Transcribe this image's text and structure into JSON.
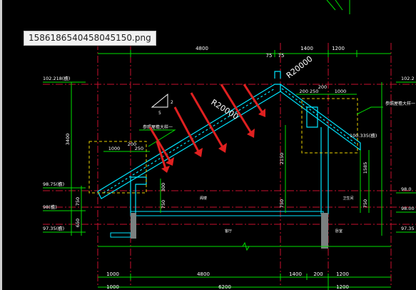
{
  "tooltip": {
    "filename": "1586186540458045150.png"
  },
  "dims": {
    "top": [
      "4800",
      "75",
      "75",
      "1400",
      "1200"
    ],
    "bottom_row1": [
      "1000",
      "4800",
      "1400",
      "200",
      "1200"
    ],
    "bottom_row2": [
      "1000",
      "6200",
      "1200"
    ],
    "right_sub": [
      "200 250",
      "200",
      "1000"
    ],
    "left_sub": [
      "1000",
      "200",
      "250"
    ]
  },
  "levels": {
    "left": [
      "102.218(檐)",
      "98.75(檐)",
      "98(檐)",
      "97.35(檐)"
    ],
    "right": [
      "102.2",
      "98.0",
      "98.00",
      "97.35"
    ],
    "mid_right": "100.335(檐)"
  },
  "vertical_dims": {
    "left_total": "3400",
    "left_a": "750",
    "left_b": "650",
    "mid_a": "300",
    "mid_b": "750",
    "center_a": "2150",
    "center_b": "750",
    "right_a": "1585",
    "right_b": "750"
  },
  "slopes": {
    "left_label": "R20000",
    "right_label": "R20000"
  },
  "notes": {
    "left_note": "参照屋檐大样一",
    "right_note": "参照屋檐大样一"
  },
  "rooms": {
    "upper_left": "阁楼",
    "upper_right": "卫生间",
    "lower_mid": "客厅",
    "lower_right": "卧室"
  },
  "slope_symbol": {
    "run": "5",
    "rise": "2"
  }
}
